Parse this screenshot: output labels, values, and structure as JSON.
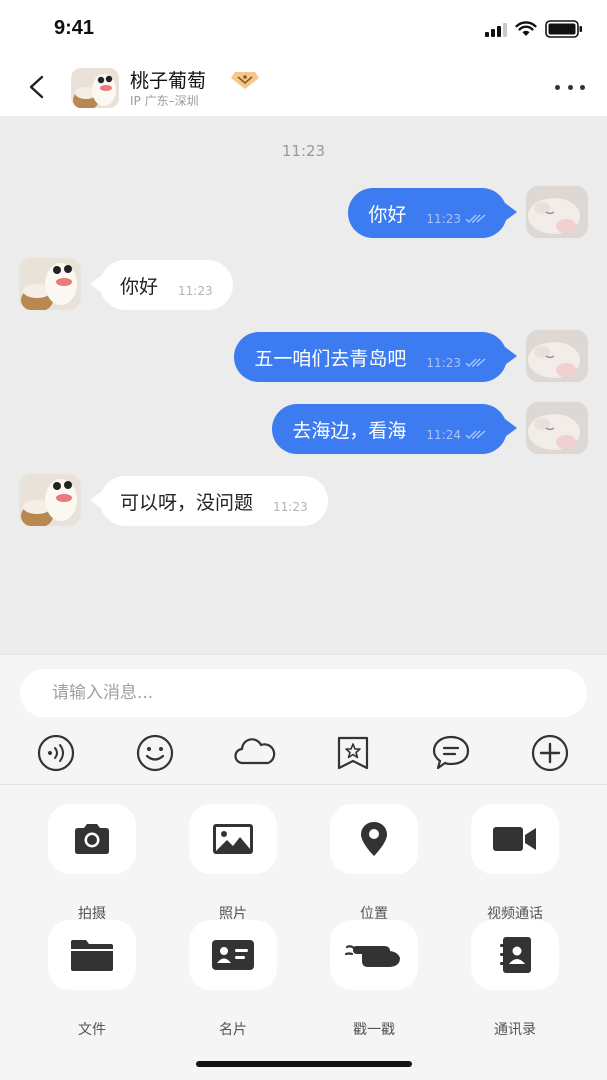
{
  "status_bar": {
    "time": "9:41"
  },
  "header": {
    "contact_name": "桃子葡萄",
    "ip_location": "IP 广东–深圳"
  },
  "chat": {
    "time_divider": "11:23",
    "messages": [
      {
        "direction": "out",
        "text": "你好",
        "time": "11:23"
      },
      {
        "direction": "in",
        "text": "你好",
        "time": "11:23"
      },
      {
        "direction": "out",
        "text": "五一咱们去青岛吧",
        "time": "11:23"
      },
      {
        "direction": "out",
        "text": "去海边，看海",
        "time": "11:24"
      },
      {
        "direction": "in",
        "text": "可以呀，没问题",
        "time": "11:23"
      }
    ]
  },
  "composer": {
    "placeholder": "请输入消息...",
    "toolbar": [
      "voice-icon",
      "emoji-icon",
      "cloud-icon",
      "favorite-icon",
      "quick-reply-icon",
      "plus-icon"
    ]
  },
  "actions": [
    {
      "label": "拍摄",
      "icon": "camera-icon"
    },
    {
      "label": "照片",
      "icon": "photo-icon"
    },
    {
      "label": "位置",
      "icon": "location-icon"
    },
    {
      "label": "视频通话",
      "icon": "video-call-icon"
    },
    {
      "label": "文件",
      "icon": "folder-icon"
    },
    {
      "label": "名片",
      "icon": "business-card-icon"
    },
    {
      "label": "戳一戳",
      "icon": "poke-icon"
    },
    {
      "label": "通讯录",
      "icon": "contacts-icon"
    }
  ],
  "colors": {
    "accent": "#3d7bf0",
    "chat_background": "#ececec",
    "panel_background": "#f5f5f5",
    "icon": "#333333"
  }
}
